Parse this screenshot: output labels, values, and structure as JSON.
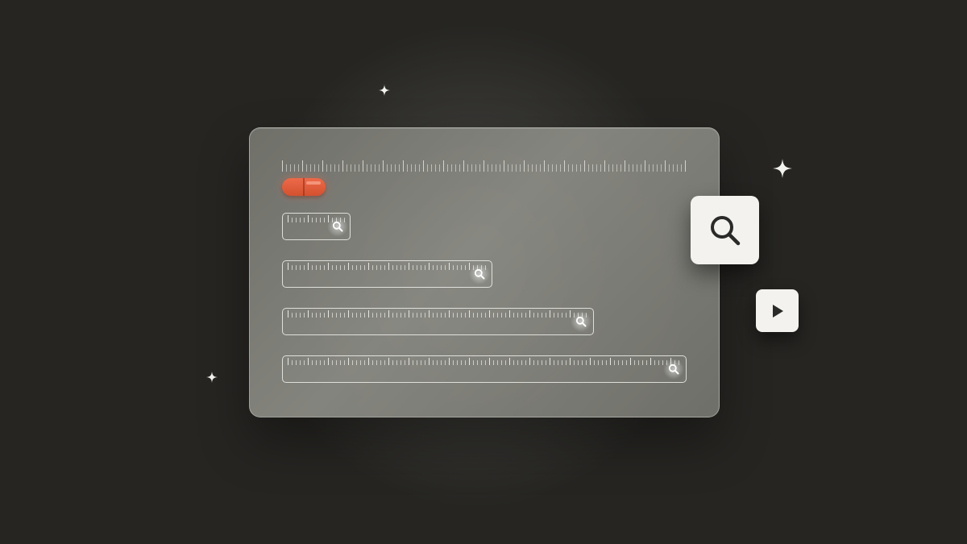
{
  "colors": {
    "background": "#262522",
    "panel": "#8a8a84",
    "record_accent": "#e05a3a",
    "tile": "#f3f2ef",
    "track_outline": "#f0f0ec",
    "icon_dark": "#2a2a28"
  },
  "icons": {
    "search": "search-icon",
    "play": "play-icon",
    "sparkle": "sparkle-icon",
    "record": "record-pill-icon"
  },
  "tracks": [
    {
      "fill": 0.17
    },
    {
      "fill": 0.52
    },
    {
      "fill": 0.77
    },
    {
      "fill": 1.0
    }
  ]
}
